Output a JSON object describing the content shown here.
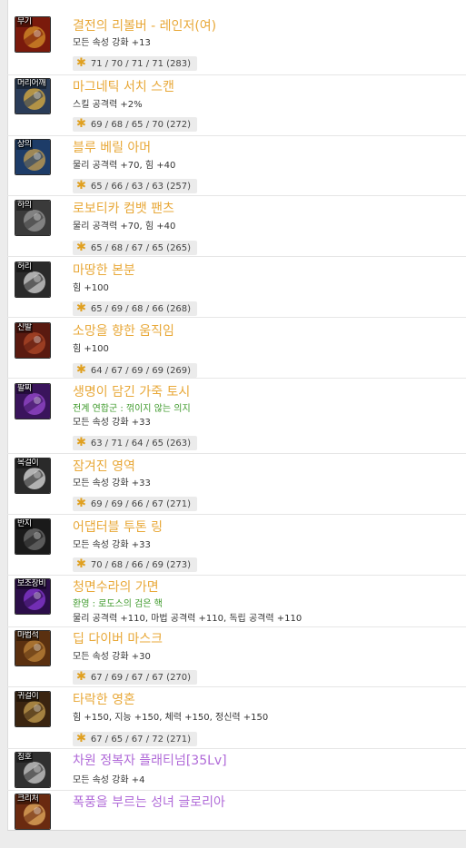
{
  "colors": {
    "legendary": "#e8a838",
    "epic": "#b06ad8",
    "set_option": "#3f9a2c",
    "star": "#e0a020"
  },
  "items": [
    {
      "slot": "무기",
      "name": "결전의 리볼버 - 레인저(여)",
      "rarity": "legendary",
      "lines": [
        {
          "text": "모든 속성 강화 +13"
        }
      ],
      "stats": "71 / 70 / 71 / 71 (283)",
      "icon": "weapon-revolver-icon"
    },
    {
      "slot": "머리어깨",
      "name": "마그네틱 서치 스캔",
      "rarity": "legendary",
      "lines": [
        {
          "text": "스킬 공격력 +2%"
        }
      ],
      "stats": "69 / 68 / 65 / 70 (272)",
      "icon": "head-shoulder-icon"
    },
    {
      "slot": "상의",
      "name": "블루 베릴 아머",
      "rarity": "legendary",
      "lines": [
        {
          "text": "물리 공격력 +70, 힘 +40"
        }
      ],
      "stats": "65 / 66 / 63 / 63 (257)",
      "icon": "armor-icon"
    },
    {
      "slot": "하의",
      "name": "로보티카 컴뱃 팬츠",
      "rarity": "legendary",
      "lines": [
        {
          "text": "물리 공격력 +70, 힘 +40"
        }
      ],
      "stats": "65 / 68 / 67 / 65 (265)",
      "icon": "pants-icon"
    },
    {
      "slot": "허리",
      "name": "마땅한 본분",
      "rarity": "legendary",
      "lines": [
        {
          "text": "힘 +100"
        }
      ],
      "stats": "65 / 69 / 68 / 66 (268)",
      "icon": "belt-icon"
    },
    {
      "slot": "신발",
      "name": "소망을 향한 움직임",
      "rarity": "legendary",
      "lines": [
        {
          "text": "힘 +100"
        }
      ],
      "stats": "64 / 67 / 69 / 69 (269)",
      "icon": "shoes-icon"
    },
    {
      "slot": "팔찌",
      "name": "생명이 담긴 가죽 토시",
      "rarity": "legendary",
      "lines": [
        {
          "text": "전계 연합군 : 꺾이지 않는 의지",
          "kind": "set"
        },
        {
          "text": "모든 속성 강화 +33"
        }
      ],
      "stats": "63 / 71 / 64 / 65 (263)",
      "icon": "bracelet-icon"
    },
    {
      "slot": "목걸이",
      "name": "잠겨진 영역",
      "rarity": "legendary",
      "lines": [
        {
          "text": "모든 속성 강화 +33"
        }
      ],
      "stats": "69 / 69 / 66 / 67 (271)",
      "icon": "necklace-icon"
    },
    {
      "slot": "반지",
      "name": "어댑터블 투톤 링",
      "rarity": "legendary",
      "lines": [
        {
          "text": "모든 속성 강화 +33"
        }
      ],
      "stats": "70 / 68 / 66 / 69 (273)",
      "icon": "ring-icon"
    },
    {
      "slot": "보조장비",
      "name": "청면수라의 가면",
      "rarity": "legendary",
      "lines": [
        {
          "text": "환영 : 로도스의 검은 핵",
          "kind": "set"
        },
        {
          "text": "물리 공격력 +110, 마법 공격력 +110, 독립 공격력 +110"
        }
      ],
      "stats": "",
      "icon": "mask-icon"
    },
    {
      "slot": "마법석",
      "name": "딥 다이버 마스크",
      "rarity": "legendary",
      "lines": [
        {
          "text": "모든 속성 강화 +30"
        }
      ],
      "stats": "67 / 69 / 67 / 67 (270)",
      "icon": "magic-stone-icon"
    },
    {
      "slot": "귀걸이",
      "name": "타락한 영혼",
      "rarity": "legendary",
      "lines": [
        {
          "text": "힘 +150, 지능 +150, 체력 +150, 정신력 +150"
        }
      ],
      "stats": "67 / 65 / 67 / 72 (271)",
      "icon": "earring-icon"
    },
    {
      "slot": "칭호",
      "name": "차원 정복자 플래티넘[35Lv]",
      "rarity": "epic",
      "lines": [
        {
          "text": "모든 속성 강화 +4"
        }
      ],
      "stats": "",
      "icon": "title-icon"
    },
    {
      "slot": "크리처",
      "name": "폭풍을 부르는 성녀 글로리아",
      "rarity": "epic",
      "lines": [],
      "stats": "",
      "icon": "creature-icon"
    }
  ]
}
